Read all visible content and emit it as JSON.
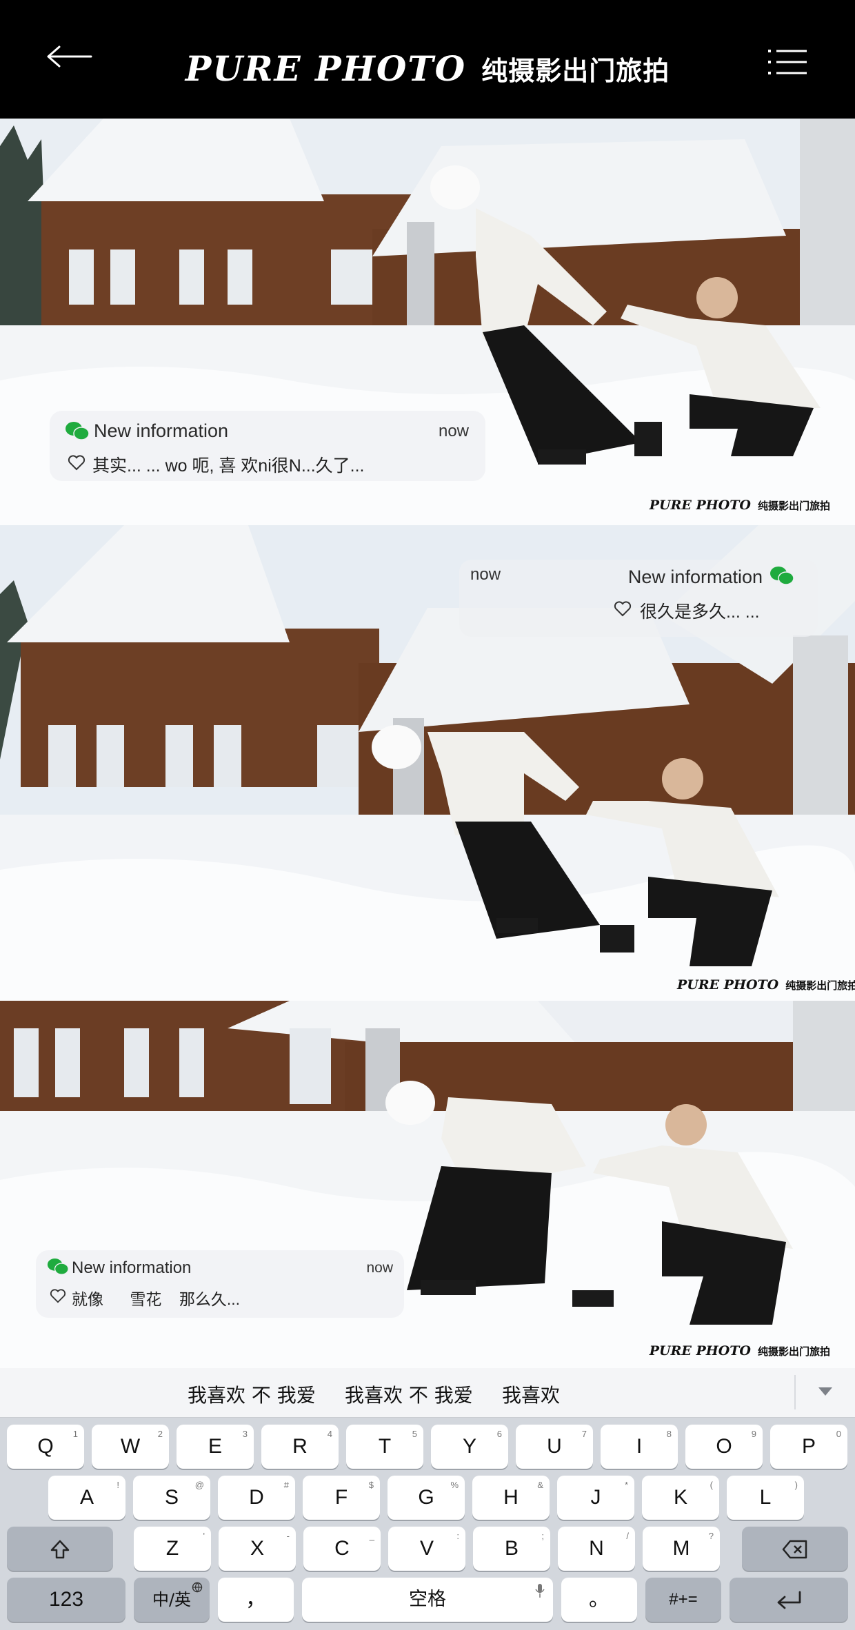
{
  "header": {
    "brand_logo": "PURE PHOTO",
    "brand_subtitle": "纯摄影出门旅拍",
    "back_icon": "arrow-left-icon",
    "menu_icon": "list-menu-icon"
  },
  "photos": [
    {
      "watermark_logo": "PURE PHOTO",
      "watermark_sub": "纯摄影出门旅拍",
      "notification": {
        "title": "New information",
        "time": "now",
        "message": "其实... ... wo 呃, 喜 欢ni很N...久了..."
      }
    },
    {
      "watermark_logo": "PURE PHOTO",
      "watermark_sub": "纯摄影出门旅拍",
      "notification": {
        "title": "New information",
        "time": "now",
        "message": "很久是多久... ..."
      }
    },
    {
      "watermark_logo": "PURE PHOTO",
      "watermark_sub": "纯摄影出门旅拍",
      "notification": {
        "title": "New information",
        "time": "now",
        "message": "就像      雪花    那么久..."
      }
    }
  ],
  "keyboard": {
    "suggestions": [
      "我喜欢 不 我爱",
      "我喜欢 不 我爱",
      "我喜欢"
    ],
    "row1": [
      {
        "label": "Q",
        "hint": "1"
      },
      {
        "label": "W",
        "hint": "2"
      },
      {
        "label": "E",
        "hint": "3"
      },
      {
        "label": "R",
        "hint": "4"
      },
      {
        "label": "T",
        "hint": "5"
      },
      {
        "label": "Y",
        "hint": "6"
      },
      {
        "label": "U",
        "hint": "7"
      },
      {
        "label": "I",
        "hint": "8"
      },
      {
        "label": "O",
        "hint": "9"
      },
      {
        "label": "P",
        "hint": "0"
      }
    ],
    "row2": [
      {
        "label": "A",
        "hint": "!"
      },
      {
        "label": "S",
        "hint": "@"
      },
      {
        "label": "D",
        "hint": "#"
      },
      {
        "label": "F",
        "hint": "$"
      },
      {
        "label": "G",
        "hint": "%"
      },
      {
        "label": "H",
        "hint": "&"
      },
      {
        "label": "J",
        "hint": "*"
      },
      {
        "label": "K",
        "hint": "("
      },
      {
        "label": "L",
        "hint": ")"
      }
    ],
    "row3": [
      {
        "label": "Z",
        "hint": "'"
      },
      {
        "label": "X",
        "hint": "-"
      },
      {
        "label": "C",
        "hint": "_"
      },
      {
        "label": "V",
        "hint": ":"
      },
      {
        "label": "B",
        "hint": ";"
      },
      {
        "label": "N",
        "hint": "/"
      },
      {
        "label": "M",
        "hint": "?"
      }
    ],
    "key_123": "123",
    "key_lang": "中/英",
    "key_comma": "，",
    "key_space": "空格",
    "key_period": "。",
    "key_symbols": "#+=",
    "shift_icon": "shift-icon",
    "backspace_icon": "backspace-icon",
    "enter_icon": "enter-icon",
    "mic_icon": "mic-icon",
    "globe_icon": "globe-icon"
  }
}
